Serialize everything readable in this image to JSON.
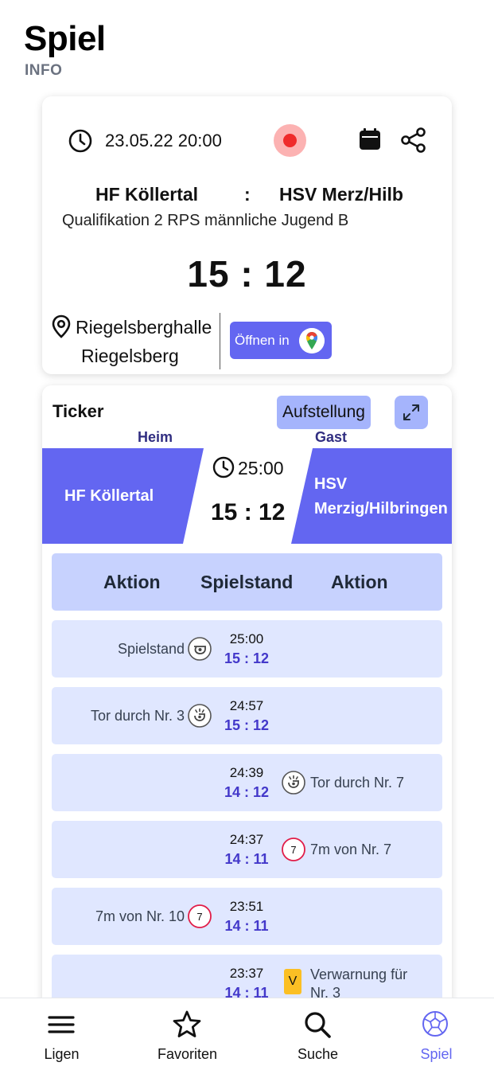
{
  "header": {
    "title": "Spiel",
    "subtitle": "INFO"
  },
  "match": {
    "datetime": "23.05.22 20:00",
    "home_team": "HF Köllertal",
    "separator": ":",
    "away_team": "HSV Merz/Hilb",
    "competition": "Qualifikation 2 RPS männliche Jugend B",
    "score": "15 : 12",
    "venue_name": "Riegelsberghalle",
    "venue_city": "Riegelsberg",
    "maps_button_label": "Öffnen in",
    "live_color": "#ef2b2b"
  },
  "ticker": {
    "title": "Ticker",
    "lineup_button": "Aufstellung",
    "home_label": "Heim",
    "away_label": "Gast",
    "home_team": "HF Köllertal",
    "away_team_line1": "HSV",
    "away_team_line2": "Merzig/Hilbringen",
    "time": "25:00",
    "score": "15 : 12",
    "accent_color": "#6366f1",
    "columns": {
      "left": "Aktion",
      "mid": "Spielstand",
      "right": "Aktion"
    },
    "events": [
      {
        "left": "Spielstand",
        "left_icon": "whistle-icon",
        "right": "",
        "time": "25:00",
        "score": "15 : 12"
      },
      {
        "left": "Tor durch Nr. 3",
        "left_icon": "goal-whistle-icon",
        "right": "",
        "time": "24:57",
        "score": "15 : 12"
      },
      {
        "left": "",
        "right": "Tor durch Nr. 7",
        "right_icon": "goal-whistle-icon",
        "time": "24:39",
        "score": "14 : 12"
      },
      {
        "left": "",
        "right": "7m von Nr. 7",
        "right_icon": "seven-meter-icon",
        "time": "24:37",
        "score": "14 : 11"
      },
      {
        "left": "7m von Nr. 10",
        "left_icon": "seven-meter-icon",
        "right": "",
        "time": "23:51",
        "score": "14 : 11"
      },
      {
        "left": "",
        "right_line1": "Verwarnung für",
        "right_line2": "Nr. 3",
        "right_icon": "yellow-card-icon",
        "badge": "V",
        "time": "23:37",
        "score": "14 : 11"
      }
    ]
  },
  "nav": {
    "items": [
      {
        "label": "Ligen",
        "icon": "menu-icon"
      },
      {
        "label": "Favoriten",
        "icon": "star-icon"
      },
      {
        "label": "Suche",
        "icon": "search-icon"
      },
      {
        "label": "Spiel",
        "icon": "ball-icon"
      }
    ],
    "active_color": "#6366f1"
  }
}
